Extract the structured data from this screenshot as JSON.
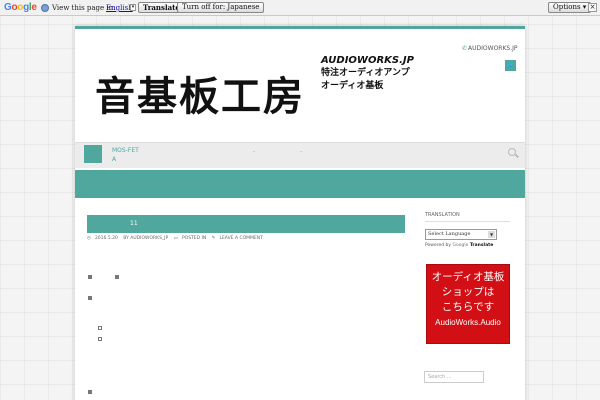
{
  "translate_bar": {
    "logo": [
      "G",
      "o",
      "o",
      "g",
      "l",
      "e"
    ],
    "view_text": "View this page in:",
    "language": "English",
    "caret": "▾",
    "translate_label": "Translate",
    "turnoff_label": "Turn off for: Japanese",
    "options_label": "Options ▾",
    "close_label": "×"
  },
  "header": {
    "logo_text": "音基板工房",
    "logo_en": "AUDIOWORKS.JP",
    "tagline_1": "特注オーディオアンプ",
    "tagline_2": "オーディオ基板",
    "contact": "AUDIOWORKS.JP",
    "twitter_glyph": "🐦"
  },
  "nav": {
    "item_line1": "MOS-FET",
    "item_line2": "A",
    "dots": "- -"
  },
  "post": {
    "title": "11",
    "date": "2016.5.20",
    "author": "BY AUDIOWORKS_JP",
    "posted": "POSTED IN",
    "comment": "LEAVE A COMMENT"
  },
  "sidebar": {
    "translation_title": "TRANSLATION",
    "select_value": "Select Language",
    "powered_by": "Powered by",
    "powered_google": "Google",
    "powered_translate": "Translate",
    "banner_line1": "オーディオ基板",
    "banner_line2": "ショップは",
    "banner_line3": "こちらです",
    "banner_line4": "AudioWorks.Audio",
    "search_placeholder": "Search ..."
  },
  "colors": {
    "accent": "#4fa79e",
    "banner": "#d10f15"
  }
}
